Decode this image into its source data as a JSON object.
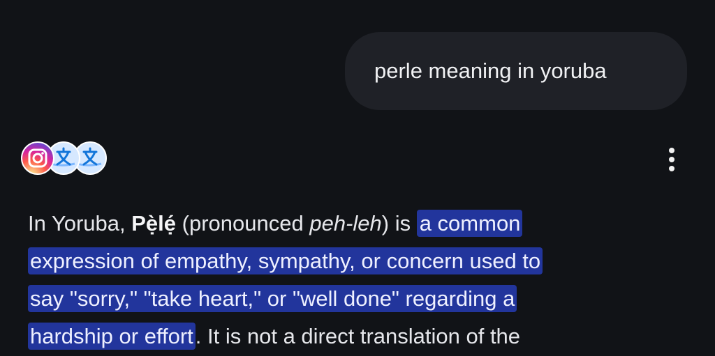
{
  "conversation": {
    "user_query": "perle meaning in yoruba"
  },
  "response": {
    "source_icons": [
      "instagram-icon",
      "translate-icon",
      "translate-icon"
    ],
    "menu_icon": "more-vert-icon",
    "colors": {
      "background": "#111317",
      "query_bubble": "#1f2127",
      "highlight": "#22359c"
    },
    "answer": {
      "prefix": "In Yoruba, ",
      "term": "Pẹ̀lẹ́",
      "pronounced_open": " (pronounced ",
      "pronunciation": "peh-leh",
      "pronounced_close": ") is ",
      "highlight_line_1": "a common",
      "highlight_line_2": "expression of empathy, sympathy, or concern used to",
      "highlight_line_3": "say \"sorry,\" \"take heart,\" or \"well done\" regarding a",
      "highlight_line_4": "hardship or effort",
      "suffix": ". It is not a direct translation of the"
    }
  }
}
